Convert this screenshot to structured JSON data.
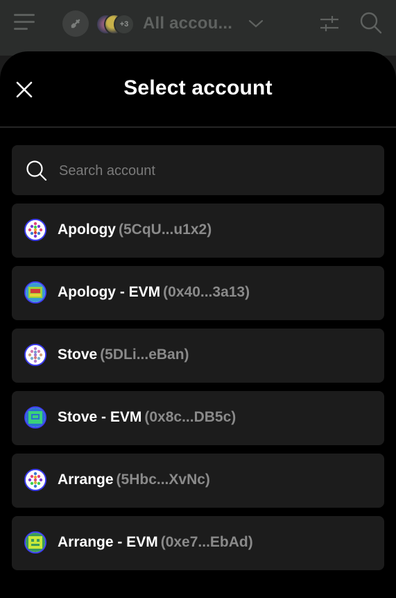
{
  "header": {
    "all_accounts_label": "All accou...",
    "more_accounts_badge": "+3"
  },
  "sheet": {
    "title": "Select account",
    "search": {
      "placeholder": "Search account",
      "value": ""
    }
  },
  "accounts": [
    {
      "name": "Apology",
      "address": "(5CqU...u1x2)"
    },
    {
      "name": "Apology - EVM",
      "address": "(0x40...3a13)"
    },
    {
      "name": "Stove",
      "address": "(5DLi...eBan)"
    },
    {
      "name": "Stove - EVM",
      "address": "(0x8c...DB5c)"
    },
    {
      "name": "Arrange",
      "address": "(5Hbc...XvNc)"
    },
    {
      "name": "Arrange - EVM",
      "address": "(0xe7...EbAd)"
    }
  ],
  "colors": {
    "sheet_bg": "#000000",
    "row_bg": "#1c1c1c",
    "address_text": "#8a8a8a",
    "avatar_ring": "#3c3cf0"
  }
}
